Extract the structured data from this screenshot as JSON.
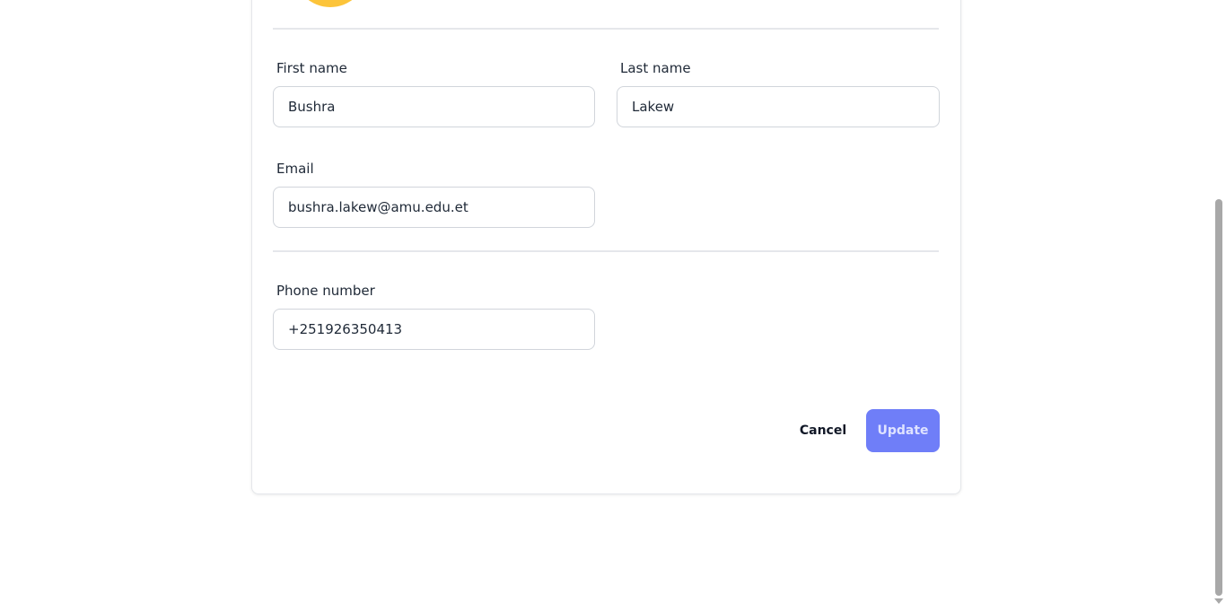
{
  "profile_form": {
    "first_name": {
      "label": "First name",
      "value": "Bushra"
    },
    "last_name": {
      "label": "Last name",
      "value": "Lakew"
    },
    "email": {
      "label": "Email",
      "value": "bushra.lakew@amu.edu.et"
    },
    "phone": {
      "label": "Phone number",
      "value": "+251926350413"
    }
  },
  "actions": {
    "cancel_label": "Cancel",
    "update_label": "Update"
  },
  "colors": {
    "avatar": "#fcc43a",
    "accent": "#6f7ef8",
    "border": "#d1d5db",
    "divider": "#e5e7eb"
  },
  "icons": {
    "scroll_down": "chevron-down-icon"
  }
}
